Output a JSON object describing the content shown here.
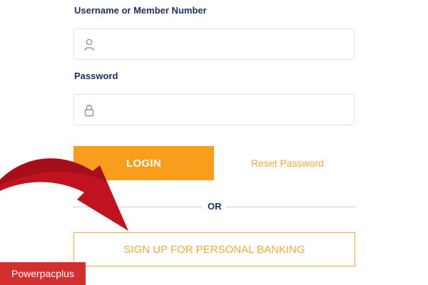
{
  "form": {
    "username_label": "Username or Member Number",
    "username_value": "",
    "password_label": "Password",
    "password_value": "",
    "login_label": "LOGIN",
    "reset_label": "Reset Password",
    "or_label": "OR",
    "signup_label": "SIGN UP FOR PERSONAL BANKING"
  },
  "icons": {
    "username": "user-icon",
    "password": "lock-icon",
    "annotation": "red-arrow"
  },
  "watermark": {
    "text": "Powerpacplus"
  },
  "colors": {
    "label": "#1c2f5e",
    "accent": "#f99d1c",
    "link": "#f0a93c",
    "arrow": "#c0121f",
    "watermark_bg": "#d32f2f"
  }
}
